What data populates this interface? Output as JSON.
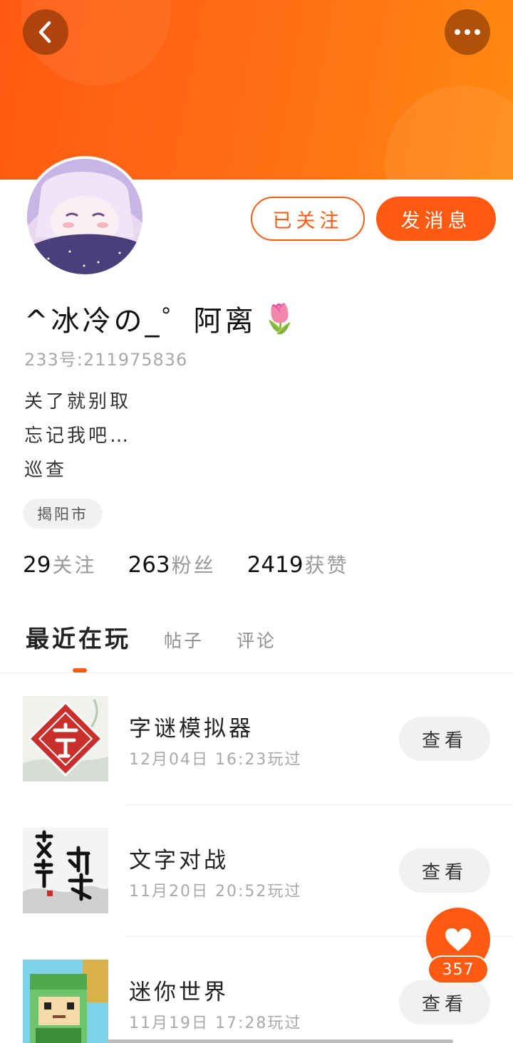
{
  "header": {
    "back_icon": "chevron-left-icon",
    "more_icon": "ellipsis-icon",
    "banner_color": "#ff6a14"
  },
  "profile": {
    "nickname": "^冰冷の_゜阿离",
    "nickname_emoji": "🌷",
    "uid": "233号:211975836",
    "bio_lines": [
      "关了就别取",
      "忘记我吧…",
      "巡查"
    ],
    "location": "揭阳市",
    "follow_button": "已关注",
    "message_button": "发消息"
  },
  "stats": {
    "following_count": "29",
    "following_label": "关注",
    "fans_count": "263",
    "fans_label": "粉丝",
    "likes_count": "2419",
    "likes_label": "获赞"
  },
  "tabs": {
    "items": [
      {
        "label": "最近在玩",
        "active": true
      },
      {
        "label": "帖子",
        "active": false
      },
      {
        "label": "评论",
        "active": false
      }
    ]
  },
  "games": [
    {
      "title": "字谜模拟器",
      "time": "12月04日 16:23玩过",
      "view_label": "查看"
    },
    {
      "title": "文字对战",
      "time": "11月20日 20:52玩过",
      "view_label": "查看"
    },
    {
      "title": "迷你世界",
      "time": "11月19日 17:28玩过",
      "view_label": "查看"
    }
  ],
  "fab": {
    "icon": "heart-icon",
    "count": "357"
  },
  "colors": {
    "accent": "#ff5a12",
    "muted_text": "#a9a9a9"
  }
}
